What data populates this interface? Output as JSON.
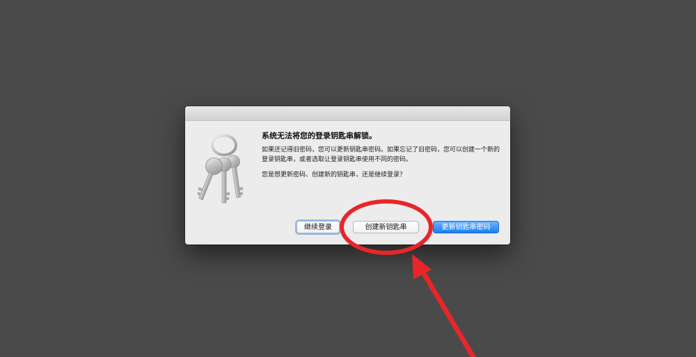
{
  "dialog": {
    "heading": "系统无法将您的登录钥匙串解锁。",
    "body": "如果还记得旧密码，您可以更新钥匙串密码。如果忘记了旧密码，您可以创建一个新的登录钥匙串，或者选取让登录钥匙串使用不同的密码。",
    "question": "您是想更新密码、创建新的钥匙串，还是继续登录？",
    "icon": "keychain-keys-icon",
    "buttons": {
      "continue_login": "继续登录",
      "create_new_keychain": "创建新钥匙串",
      "update_keychain_password": "更新钥匙串密码"
    }
  },
  "annotation": {
    "color": "#e8262a"
  },
  "colors": {
    "desktop": "#4a4a4a",
    "dialog_bg": "#ececec",
    "primary_button": "#1c7ef2"
  }
}
